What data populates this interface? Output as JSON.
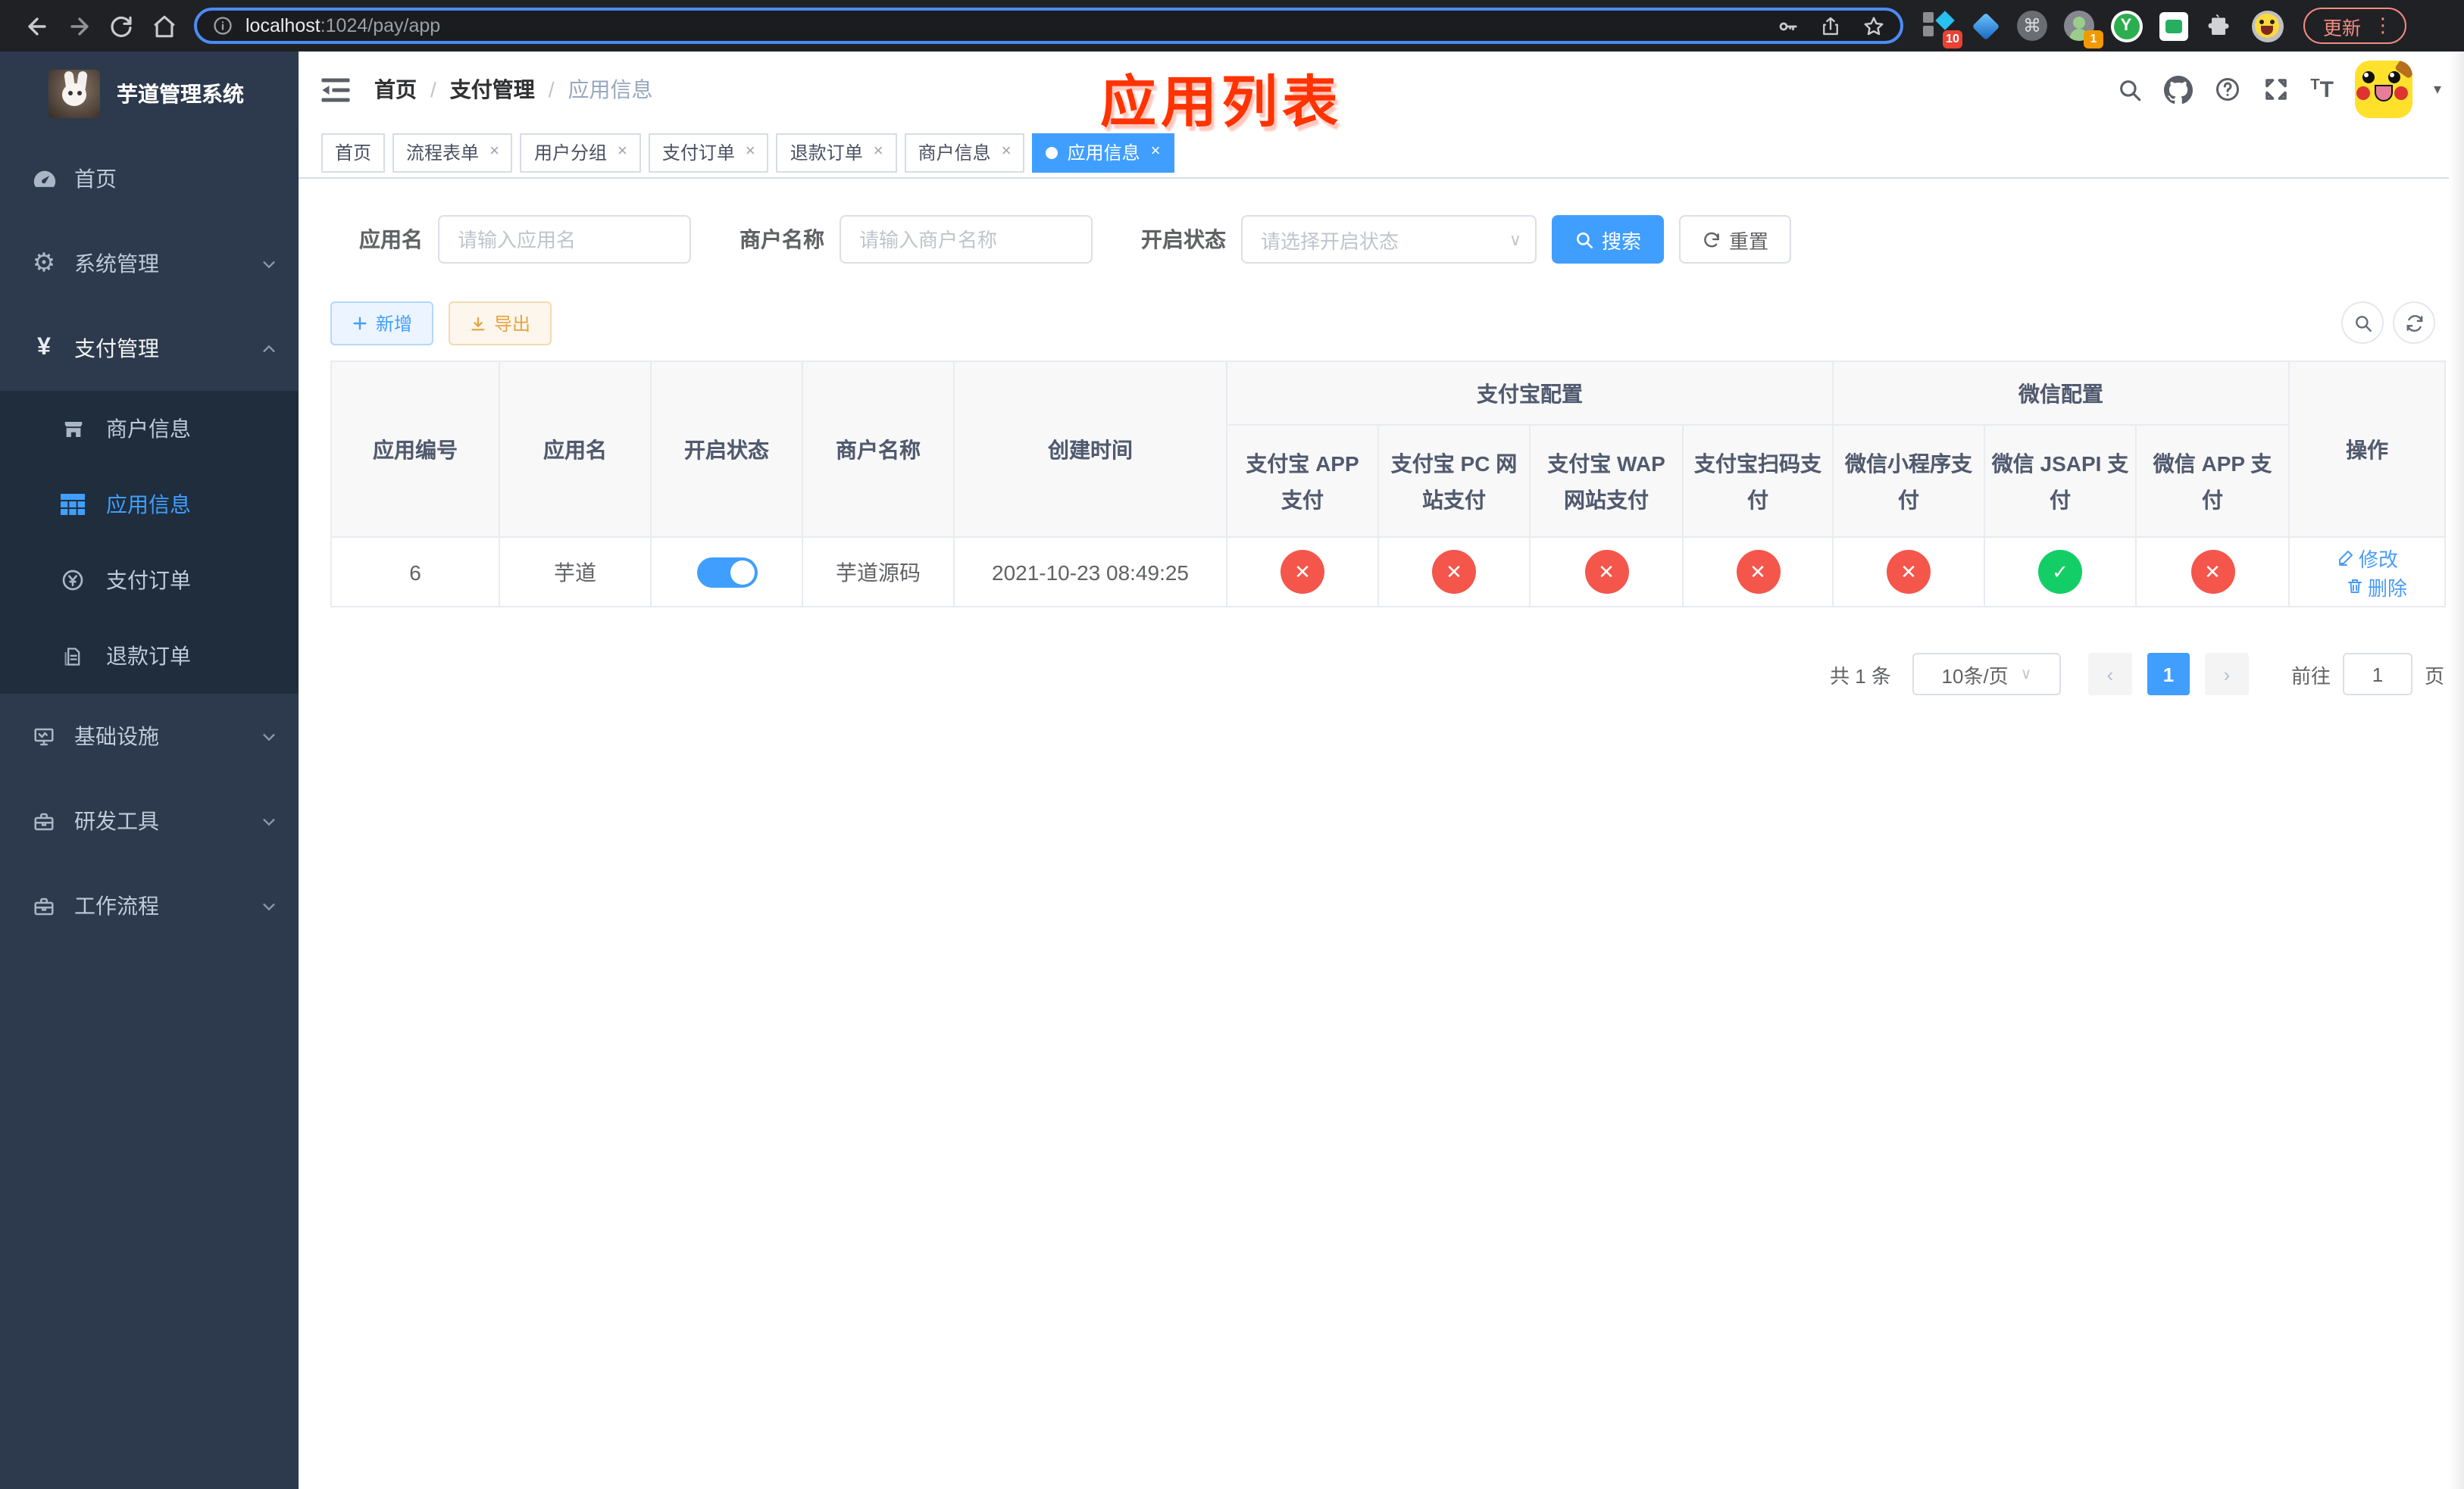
{
  "colors": {
    "primary": "#409eff",
    "success": "#13ce66",
    "danger": "#f5564c",
    "annotation": "#ff3300",
    "sidebar_bg": "#2d3a4d",
    "submenu_bg": "#1f2d3d"
  },
  "icons": {
    "close": "×",
    "slash": "/",
    "chevron_down": "∨",
    "caret_down": "▾",
    "command": "⌘",
    "more_vertical": "⋮",
    "yen": "¥",
    "gear": "⚙",
    "plus": "＋",
    "pager_prev": "‹",
    "pager_next": "›",
    "y_letter": "Y",
    "big_tt": "T",
    "small_t": "T"
  },
  "browser": {
    "url_host": "localhost",
    "url_rest": ":1024/pay/app",
    "ext_badge_group": "10",
    "ext_badge_profile": "1",
    "update_label": "更新"
  },
  "sidebar": {
    "title": "芋道管理系统",
    "items": [
      {
        "label": "首页"
      },
      {
        "label": "系统管理"
      },
      {
        "label": "支付管理"
      },
      {
        "label": "基础设施"
      },
      {
        "label": "研发工具"
      },
      {
        "label": "工作流程"
      }
    ],
    "payment_children": [
      {
        "label": "商户信息"
      },
      {
        "label": "应用信息"
      },
      {
        "label": "支付订单"
      },
      {
        "label": "退款订单"
      }
    ]
  },
  "header": {
    "breadcrumb": [
      "首页",
      "支付管理",
      "应用信息"
    ],
    "annotation": "应用列表"
  },
  "tabs": [
    {
      "label": "首页"
    },
    {
      "label": "流程表单"
    },
    {
      "label": "用户分组"
    },
    {
      "label": "支付订单"
    },
    {
      "label": "退款订单"
    },
    {
      "label": "商户信息"
    },
    {
      "label": "应用信息"
    }
  ],
  "filters": {
    "name_label": "应用名",
    "name_placeholder": "请输入应用名",
    "merchant_label": "商户名称",
    "merchant_placeholder": "请输入商户名称",
    "status_label": "开启状态",
    "status_placeholder": "请选择开启状态",
    "search_label": "搜索",
    "reset_label": "重置"
  },
  "toolbar": {
    "add_label": "新增",
    "export_label": "导出"
  },
  "table": {
    "simple_columns": [
      "应用编号",
      "应用名",
      "开启状态",
      "商户名称",
      "创建时间"
    ],
    "groups": [
      {
        "label": "支付宝配置",
        "children": [
          "支付宝 APP 支付",
          "支付宝 PC 网站支付",
          "支付宝 WAP 网站支付",
          "支付宝扫码支付"
        ]
      },
      {
        "label": "微信配置",
        "children": [
          "微信小程序支付",
          "微信 JSAPI 支付",
          "微信 APP 支付"
        ]
      }
    ],
    "ops_column": "操作",
    "row": {
      "id": "6",
      "name": "芋道",
      "enabled": "on",
      "merchant": "芋道源码",
      "created": "2021-10-23 08:49:25",
      "statuses": [
        "fail",
        "fail",
        "fail",
        "fail",
        "fail",
        "success",
        "fail"
      ],
      "edit_label": "修改",
      "delete_label": "删除"
    }
  },
  "pagination": {
    "total": "共 1 条",
    "page_size": "10条/页",
    "current": "1",
    "goto_prefix": "前往",
    "goto_value": "1",
    "goto_suffix": "页"
  }
}
